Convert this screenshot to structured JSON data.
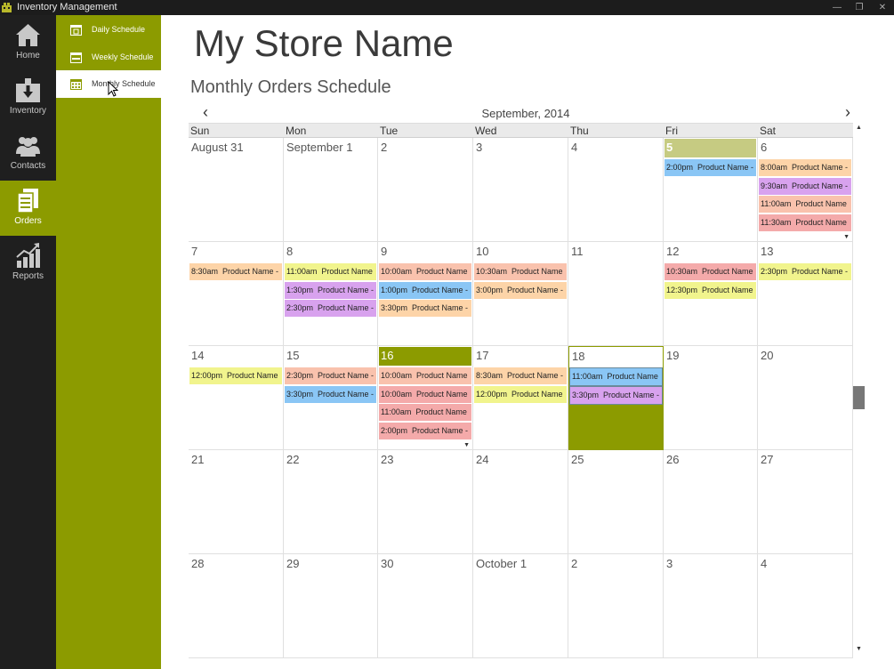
{
  "window": {
    "title": "Inventory Management",
    "minimize": "—",
    "restore": "❐",
    "close": "✕"
  },
  "nav": [
    {
      "label": "Home",
      "icon": "home-icon",
      "active": false
    },
    {
      "label": "Inventory",
      "icon": "inventory-box-icon",
      "active": false
    },
    {
      "label": "Contacts",
      "icon": "contacts-icon",
      "active": false
    },
    {
      "label": "Orders",
      "icon": "orders-icon",
      "active": true
    },
    {
      "label": "Reports",
      "icon": "reports-chart-icon",
      "active": false
    }
  ],
  "subnav": [
    {
      "label": "Daily Schedule",
      "icon": "daily-calendar-icon",
      "active": false
    },
    {
      "label": "Weekly Schedule",
      "icon": "weekly-calendar-icon",
      "active": false
    },
    {
      "label": "Monthly Schedule",
      "icon": "monthly-calendar-icon",
      "active": true
    }
  ],
  "store_name": "My Store Name",
  "section_title": "Monthly Orders Schedule",
  "calendar": {
    "month_label": "September, 2014",
    "prev_glyph": "‹",
    "next_glyph": "›",
    "weekdays": [
      "Sun",
      "Mon",
      "Tue",
      "Wed",
      "Thu",
      "Fri",
      "Sat"
    ],
    "weeks": [
      [
        {
          "label": "August 31",
          "events": []
        },
        {
          "label": "September 1",
          "events": []
        },
        {
          "label": "2",
          "events": []
        },
        {
          "label": "3",
          "events": []
        },
        {
          "label": "4",
          "events": []
        },
        {
          "label": "5",
          "state": "highlight",
          "events": [
            {
              "time": "2:00pm",
              "text": "Product Name -",
              "color": "blue"
            }
          ]
        },
        {
          "label": "6",
          "more": true,
          "events": [
            {
              "time": "8:00am",
              "text": "Product Name -",
              "color": "orange"
            },
            {
              "time": "9:30am",
              "text": "Product Name -",
              "color": "purple"
            },
            {
              "time": "11:00am",
              "text": "Product Name",
              "color": "salmon"
            },
            {
              "time": "11:30am",
              "text": "Product Name",
              "color": "pink"
            }
          ]
        }
      ],
      [
        {
          "label": "7",
          "events": [
            {
              "time": "8:30am",
              "text": "Product Name -",
              "color": "orange"
            }
          ]
        },
        {
          "label": "8",
          "events": [
            {
              "time": "11:00am",
              "text": "Product Name",
              "color": "yellow"
            },
            {
              "time": "1:30pm",
              "text": "Product Name -",
              "color": "purple"
            },
            {
              "time": "2:30pm",
              "text": "Product Name -",
              "color": "purple"
            }
          ]
        },
        {
          "label": "9",
          "events": [
            {
              "time": "10:00am",
              "text": "Product Name",
              "color": "salmon"
            },
            {
              "time": "1:00pm",
              "text": "Product Name -",
              "color": "blue"
            },
            {
              "time": "3:30pm",
              "text": "Product Name -",
              "color": "orange"
            }
          ]
        },
        {
          "label": "10",
          "events": [
            {
              "time": "10:30am",
              "text": "Product Name",
              "color": "salmon"
            },
            {
              "time": "3:00pm",
              "text": "Product Name -",
              "color": "orange"
            }
          ]
        },
        {
          "label": "11",
          "events": []
        },
        {
          "label": "12",
          "events": [
            {
              "time": "10:30am",
              "text": "Product Name",
              "color": "pink"
            },
            {
              "time": "12:30pm",
              "text": "Product Name",
              "color": "yellow"
            }
          ]
        },
        {
          "label": "13",
          "events": [
            {
              "time": "2:30pm",
              "text": "Product Name -",
              "color": "yellow"
            }
          ]
        }
      ],
      [
        {
          "label": "14",
          "events": [
            {
              "time": "12:00pm",
              "text": "Product Name",
              "color": "yellow"
            }
          ]
        },
        {
          "label": "15",
          "events": [
            {
              "time": "2:30pm",
              "text": "Product Name -",
              "color": "salmon"
            },
            {
              "time": "3:30pm",
              "text": "Product Name -",
              "color": "blue"
            }
          ]
        },
        {
          "label": "16",
          "state": "today",
          "more": true,
          "events": [
            {
              "time": "10:00am",
              "text": "Product Name",
              "color": "salmon"
            },
            {
              "time": "10:00am",
              "text": "Product Name",
              "color": "pink"
            },
            {
              "time": "11:00am",
              "text": "Product Name",
              "color": "pink"
            },
            {
              "time": "2:00pm",
              "text": "Product Name -",
              "color": "pink"
            }
          ]
        },
        {
          "label": "17",
          "events": [
            {
              "time": "8:30am",
              "text": "Product Name -",
              "color": "orange"
            },
            {
              "time": "12:00pm",
              "text": "Product Name",
              "color": "yellow"
            }
          ]
        },
        {
          "label": "18",
          "state": "selected",
          "events": [
            {
              "time": "11:00am",
              "text": "Product Name",
              "color": "blue"
            },
            {
              "time": "3:30pm",
              "text": "Product Name -",
              "color": "purple"
            }
          ]
        },
        {
          "label": "19",
          "events": []
        },
        {
          "label": "20",
          "events": []
        }
      ],
      [
        {
          "label": "21",
          "events": []
        },
        {
          "label": "22",
          "events": []
        },
        {
          "label": "23",
          "events": []
        },
        {
          "label": "24",
          "events": []
        },
        {
          "label": "25",
          "events": []
        },
        {
          "label": "26",
          "events": []
        },
        {
          "label": "27",
          "events": []
        }
      ],
      [
        {
          "label": "28",
          "events": []
        },
        {
          "label": "29",
          "events": []
        },
        {
          "label": "30",
          "events": []
        },
        {
          "label": "October 1",
          "events": []
        },
        {
          "label": "2",
          "events": []
        },
        {
          "label": "3",
          "events": []
        },
        {
          "label": "4",
          "events": []
        }
      ]
    ]
  },
  "colors": {
    "accent": "#8c9b00",
    "orange": "#fdd4a8",
    "purple": "#d8a2ee",
    "salmon": "#f9c2ad",
    "pink": "#f4aaaa",
    "yellow": "#f1f48d",
    "blue": "#8ac6f5"
  },
  "scroll": {
    "up_glyph": "▲",
    "down_glyph": "▼",
    "more_glyph": "▼"
  }
}
